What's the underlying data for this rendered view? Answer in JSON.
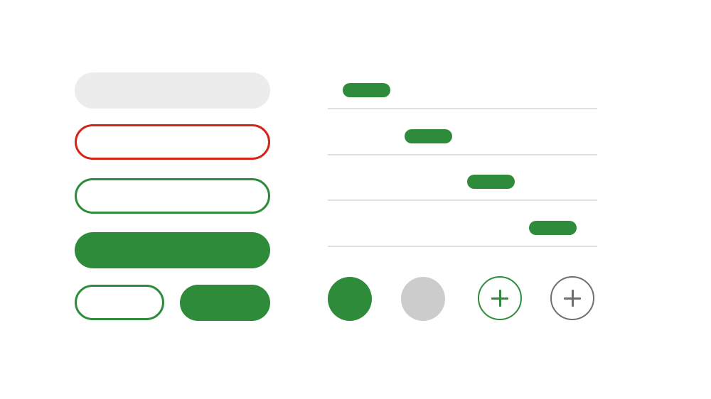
{
  "colors": {
    "accent": "#2e8b3a",
    "error": "#d42418",
    "disabled_bg": "#ececec",
    "circle_disabled": "#cccccc",
    "divider": "#e0e0e0",
    "gray_icon": "#6e6e6e"
  },
  "buttons": {
    "disabled": {
      "label": ""
    },
    "error_outline": {
      "label": ""
    },
    "outline": {
      "label": ""
    },
    "filled": {
      "label": ""
    },
    "small_outline": {
      "label": ""
    },
    "small_filled": {
      "label": ""
    }
  },
  "steps": {
    "count": 4,
    "active_positions": [
      1,
      2,
      3,
      4
    ]
  },
  "circle_buttons": [
    {
      "name": "circle-filled",
      "icon": ""
    },
    {
      "name": "circle-disabled",
      "icon": ""
    },
    {
      "name": "add-icon-button",
      "icon": "plus-icon"
    },
    {
      "name": "add-icon-button-gray",
      "icon": "plus-icon"
    }
  ]
}
